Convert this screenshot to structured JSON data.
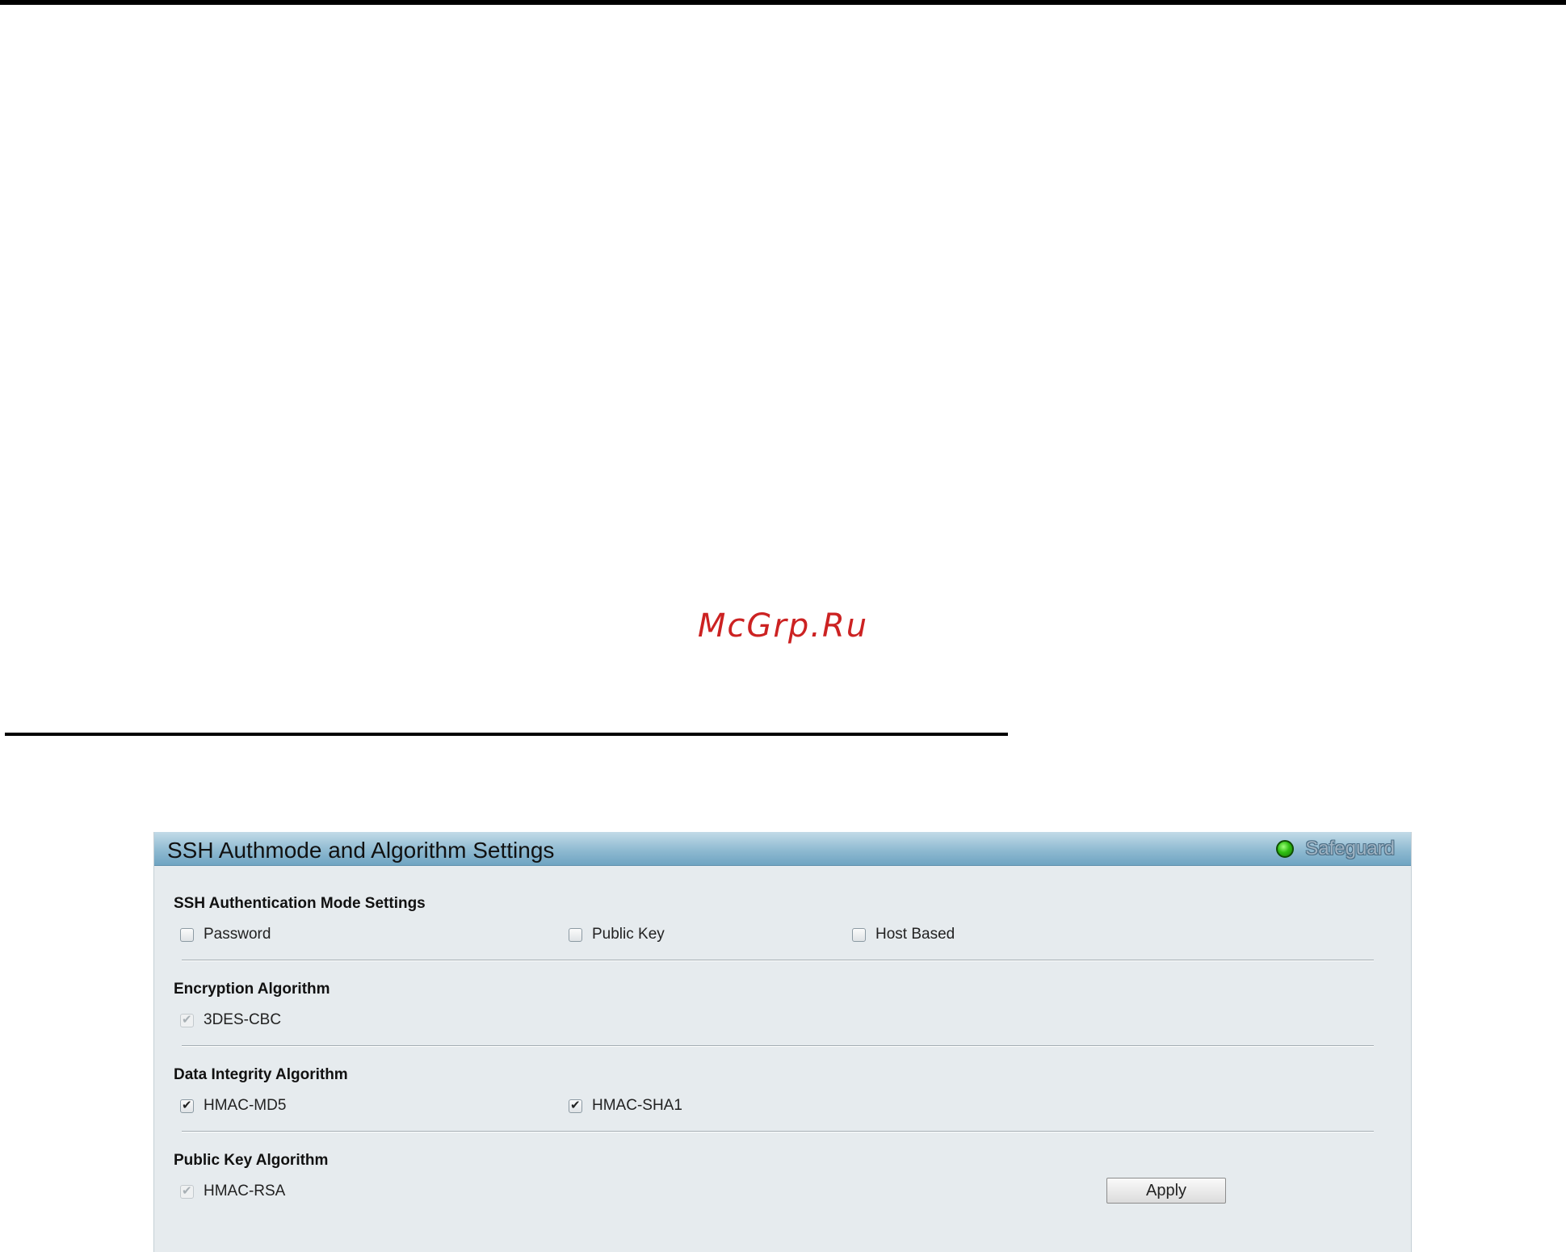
{
  "watermark": {
    "text": "McGrp.Ru"
  },
  "panel": {
    "title": "SSH Authmode and Algorithm Settings",
    "safeguard": {
      "label": "Safeguard",
      "indicator_color": "#2fbf12"
    }
  },
  "auth_mode": {
    "title": "SSH Authentication Mode Settings",
    "options": [
      {
        "label": "Password",
        "checked": false,
        "disabled": false
      },
      {
        "label": "Public Key",
        "checked": false,
        "disabled": false
      },
      {
        "label": "Host Based",
        "checked": false,
        "disabled": false
      }
    ]
  },
  "encryption": {
    "title": "Encryption Algorithm",
    "options": [
      {
        "label": "3DES-CBC",
        "checked": true,
        "disabled": true
      }
    ]
  },
  "integrity": {
    "title": "Data Integrity Algorithm",
    "options": [
      {
        "label": "HMAC-MD5",
        "checked": true,
        "disabled": false
      },
      {
        "label": "HMAC-SHA1",
        "checked": true,
        "disabled": false
      }
    ]
  },
  "public_key": {
    "title": "Public Key Algorithm",
    "options": [
      {
        "label": "HMAC-RSA",
        "checked": true,
        "disabled": true
      }
    ]
  },
  "actions": {
    "apply_label": "Apply"
  },
  "colors": {
    "header_gradient_top": "#c2dbe8",
    "header_gradient_bottom": "#6fa4c2",
    "panel_background": "#e6ebee",
    "watermark": "#cc2222"
  }
}
